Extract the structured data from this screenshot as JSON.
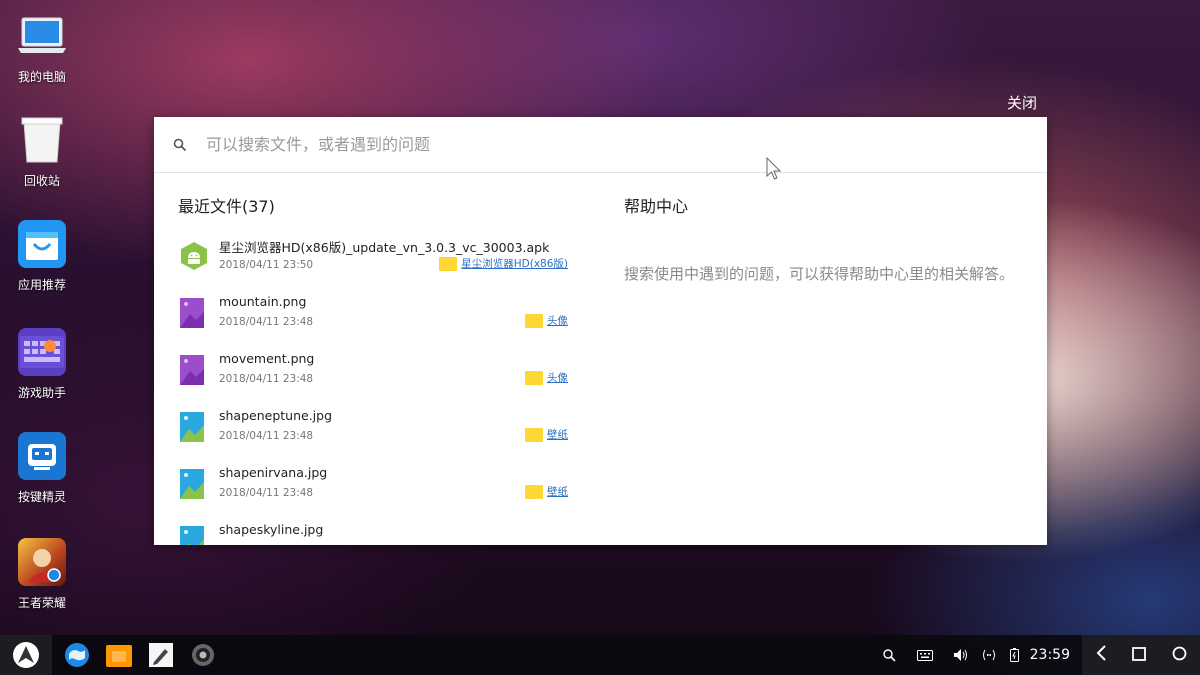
{
  "desktop": {
    "icons": [
      {
        "label": "我的电脑"
      },
      {
        "label": "回收站"
      },
      {
        "label": "应用推荐"
      },
      {
        "label": "游戏助手"
      },
      {
        "label": "按键精灵"
      },
      {
        "label": "王者荣耀"
      }
    ]
  },
  "overlay": {
    "close_label": "关闭"
  },
  "search": {
    "placeholder": "可以搜索文件，或者遇到的问题"
  },
  "recent": {
    "title": "最近文件(37)",
    "files": [
      {
        "name": "星尘浏览器HD(x86版)_update_vn_3.0.3_vc_30003.apk",
        "date": "2018/04/11 23:50",
        "folder": "星尘浏览器HD(x86版)",
        "icon": "android-icon"
      },
      {
        "name": "mountain.png",
        "date": "2018/04/11 23:48",
        "folder": "头像",
        "icon": "image-purple-icon"
      },
      {
        "name": "movement.png",
        "date": "2018/04/11 23:48",
        "folder": "头像",
        "icon": "image-purple-icon"
      },
      {
        "name": "shapeneptune.jpg",
        "date": "2018/04/11 23:48",
        "folder": "壁纸",
        "icon": "image-blue-icon"
      },
      {
        "name": "shapenirvana.jpg",
        "date": "2018/04/11 23:48",
        "folder": "壁纸",
        "icon": "image-blue-icon"
      },
      {
        "name": "shapeskyline.jpg",
        "date": "",
        "folder": "",
        "icon": "image-blue-icon"
      }
    ]
  },
  "help": {
    "title": "帮助中心",
    "description": "搜索使用中遇到的问题，可以获得帮助中心里的相关解答。"
  },
  "taskbar": {
    "clock": "23:59"
  },
  "colors": {
    "link": "#2d6fc4",
    "folder": "#fdd835",
    "android": "#8bc34a",
    "image_purple": "#9c4dcc",
    "image_blue": "#29a8e0"
  }
}
